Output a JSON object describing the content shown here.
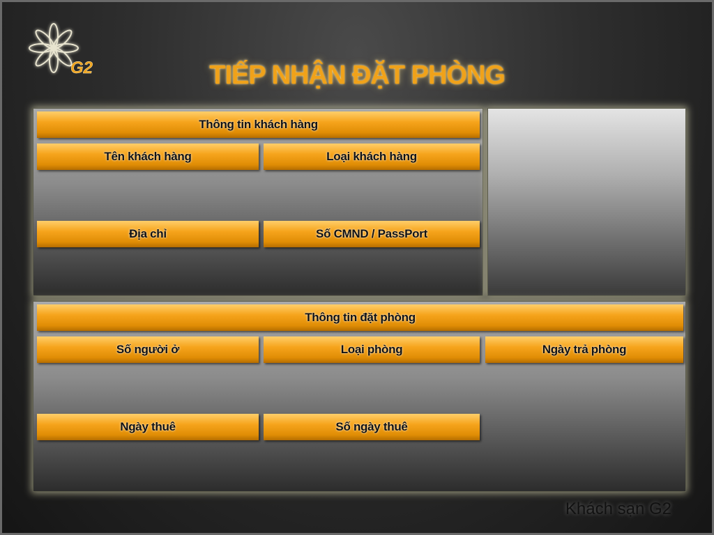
{
  "brand": {
    "logo_text": "G2",
    "logo_icon": "flower-icon"
  },
  "page_title": "TIẾP NHẬN ĐẶT PHÒNG",
  "customer_section": {
    "header": "Thông tin khách hàng",
    "fields": {
      "name": "Tên khách hàng",
      "type": "Loại khách hàng",
      "address": "Địa chỉ",
      "id_number": "Số CMND / PassPort"
    }
  },
  "booking_section": {
    "header": "Thông tin đặt phòng",
    "fields": {
      "guests": "Số người ở",
      "room_type": "Loại phòng",
      "checkout_date": "Ngày trả phòng",
      "rent_date": "Ngày thuê",
      "rent_days": "Số ngày thuê"
    }
  },
  "footer": "Khách sạn G2",
  "colors": {
    "accent": "#f6a41c",
    "title": "#f0a21a",
    "background": "#2e2e2e"
  }
}
